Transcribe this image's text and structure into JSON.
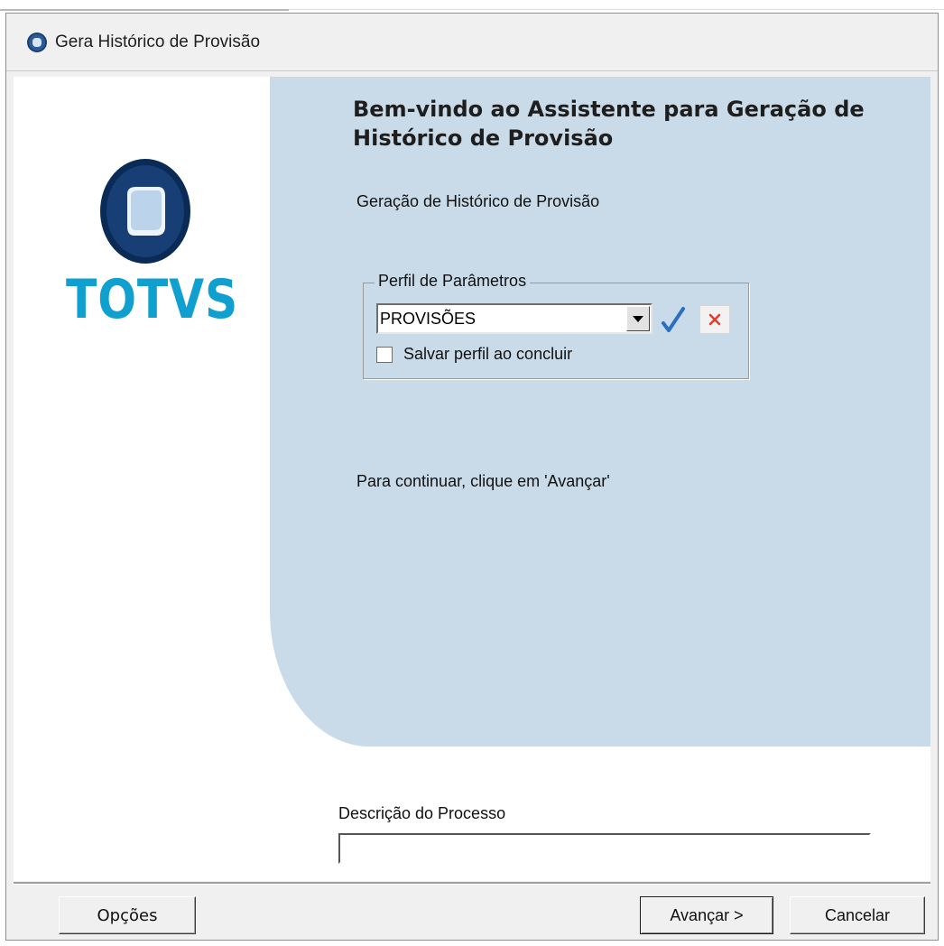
{
  "window": {
    "title": "Gera Histórico de Provisão",
    "icon": "totvs-logo-icon"
  },
  "logo": {
    "text": "TOTVS",
    "color": "#0fa0cf"
  },
  "wizard": {
    "heading": "Bem-vindo ao Assistente para Geração de Histórico de Provisão",
    "subtitle": "Geração de Histórico de Provisão",
    "continue_text": "Para continuar, clique em 'Avançar'",
    "panel_color": "#c9dbe8"
  },
  "profile_group": {
    "legend": "Perfil de Parâmetros",
    "combo_value": "PROVISÕES",
    "confirm_icon": "checkmark-icon",
    "clear_icon": "close-icon",
    "save_checkbox_label": "Salvar perfil ao concluir",
    "save_checkbox_checked": false
  },
  "process": {
    "label": "Descrição do Processo",
    "value": ""
  },
  "buttons": {
    "options": "Opções",
    "next": "Avançar >",
    "cancel": "Cancelar"
  }
}
